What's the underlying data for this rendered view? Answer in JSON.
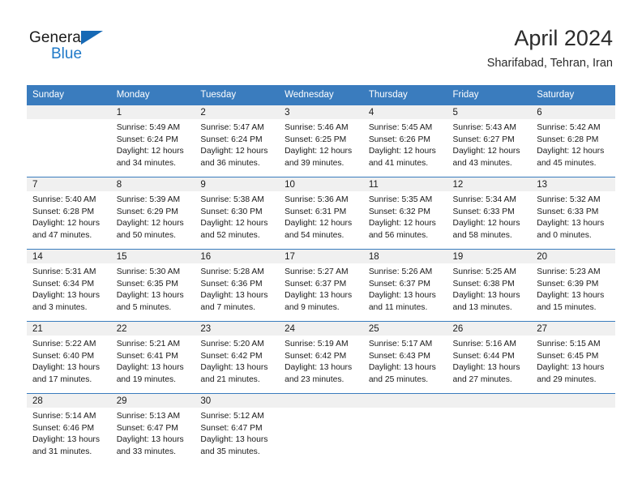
{
  "logo": {
    "text_top": "General",
    "text_bottom": "Blue",
    "triangle_color": "#1669b5",
    "blue_color": "#1f79c8"
  },
  "header": {
    "title": "April 2024",
    "subtitle": "Sharifabad, Tehran, Iran"
  },
  "theme": {
    "header_blue": "#3a7cbe",
    "daynum_band": "#f0f0f0",
    "text": "#1a1a1a"
  },
  "weekday_headers": [
    "Sunday",
    "Monday",
    "Tuesday",
    "Wednesday",
    "Thursday",
    "Friday",
    "Saturday"
  ],
  "labels": {
    "sunrise_prefix": "Sunrise: ",
    "sunset_prefix": "Sunset: ",
    "daylight_prefix": "Daylight: "
  },
  "weeks": [
    [
      {
        "day": "",
        "sunrise": "",
        "sunset": "",
        "daylight_line1": "",
        "daylight_line2": ""
      },
      {
        "day": "1",
        "sunrise": "Sunrise: 5:49 AM",
        "sunset": "Sunset: 6:24 PM",
        "daylight_line1": "Daylight: 12 hours",
        "daylight_line2": "and 34 minutes."
      },
      {
        "day": "2",
        "sunrise": "Sunrise: 5:47 AM",
        "sunset": "Sunset: 6:24 PM",
        "daylight_line1": "Daylight: 12 hours",
        "daylight_line2": "and 36 minutes."
      },
      {
        "day": "3",
        "sunrise": "Sunrise: 5:46 AM",
        "sunset": "Sunset: 6:25 PM",
        "daylight_line1": "Daylight: 12 hours",
        "daylight_line2": "and 39 minutes."
      },
      {
        "day": "4",
        "sunrise": "Sunrise: 5:45 AM",
        "sunset": "Sunset: 6:26 PM",
        "daylight_line1": "Daylight: 12 hours",
        "daylight_line2": "and 41 minutes."
      },
      {
        "day": "5",
        "sunrise": "Sunrise: 5:43 AM",
        "sunset": "Sunset: 6:27 PM",
        "daylight_line1": "Daylight: 12 hours",
        "daylight_line2": "and 43 minutes."
      },
      {
        "day": "6",
        "sunrise": "Sunrise: 5:42 AM",
        "sunset": "Sunset: 6:28 PM",
        "daylight_line1": "Daylight: 12 hours",
        "daylight_line2": "and 45 minutes."
      }
    ],
    [
      {
        "day": "7",
        "sunrise": "Sunrise: 5:40 AM",
        "sunset": "Sunset: 6:28 PM",
        "daylight_line1": "Daylight: 12 hours",
        "daylight_line2": "and 47 minutes."
      },
      {
        "day": "8",
        "sunrise": "Sunrise: 5:39 AM",
        "sunset": "Sunset: 6:29 PM",
        "daylight_line1": "Daylight: 12 hours",
        "daylight_line2": "and 50 minutes."
      },
      {
        "day": "9",
        "sunrise": "Sunrise: 5:38 AM",
        "sunset": "Sunset: 6:30 PM",
        "daylight_line1": "Daylight: 12 hours",
        "daylight_line2": "and 52 minutes."
      },
      {
        "day": "10",
        "sunrise": "Sunrise: 5:36 AM",
        "sunset": "Sunset: 6:31 PM",
        "daylight_line1": "Daylight: 12 hours",
        "daylight_line2": "and 54 minutes."
      },
      {
        "day": "11",
        "sunrise": "Sunrise: 5:35 AM",
        "sunset": "Sunset: 6:32 PM",
        "daylight_line1": "Daylight: 12 hours",
        "daylight_line2": "and 56 minutes."
      },
      {
        "day": "12",
        "sunrise": "Sunrise: 5:34 AM",
        "sunset": "Sunset: 6:33 PM",
        "daylight_line1": "Daylight: 12 hours",
        "daylight_line2": "and 58 minutes."
      },
      {
        "day": "13",
        "sunrise": "Sunrise: 5:32 AM",
        "sunset": "Sunset: 6:33 PM",
        "daylight_line1": "Daylight: 13 hours",
        "daylight_line2": "and 0 minutes."
      }
    ],
    [
      {
        "day": "14",
        "sunrise": "Sunrise: 5:31 AM",
        "sunset": "Sunset: 6:34 PM",
        "daylight_line1": "Daylight: 13 hours",
        "daylight_line2": "and 3 minutes."
      },
      {
        "day": "15",
        "sunrise": "Sunrise: 5:30 AM",
        "sunset": "Sunset: 6:35 PM",
        "daylight_line1": "Daylight: 13 hours",
        "daylight_line2": "and 5 minutes."
      },
      {
        "day": "16",
        "sunrise": "Sunrise: 5:28 AM",
        "sunset": "Sunset: 6:36 PM",
        "daylight_line1": "Daylight: 13 hours",
        "daylight_line2": "and 7 minutes."
      },
      {
        "day": "17",
        "sunrise": "Sunrise: 5:27 AM",
        "sunset": "Sunset: 6:37 PM",
        "daylight_line1": "Daylight: 13 hours",
        "daylight_line2": "and 9 minutes."
      },
      {
        "day": "18",
        "sunrise": "Sunrise: 5:26 AM",
        "sunset": "Sunset: 6:37 PM",
        "daylight_line1": "Daylight: 13 hours",
        "daylight_line2": "and 11 minutes."
      },
      {
        "day": "19",
        "sunrise": "Sunrise: 5:25 AM",
        "sunset": "Sunset: 6:38 PM",
        "daylight_line1": "Daylight: 13 hours",
        "daylight_line2": "and 13 minutes."
      },
      {
        "day": "20",
        "sunrise": "Sunrise: 5:23 AM",
        "sunset": "Sunset: 6:39 PM",
        "daylight_line1": "Daylight: 13 hours",
        "daylight_line2": "and 15 minutes."
      }
    ],
    [
      {
        "day": "21",
        "sunrise": "Sunrise: 5:22 AM",
        "sunset": "Sunset: 6:40 PM",
        "daylight_line1": "Daylight: 13 hours",
        "daylight_line2": "and 17 minutes."
      },
      {
        "day": "22",
        "sunrise": "Sunrise: 5:21 AM",
        "sunset": "Sunset: 6:41 PM",
        "daylight_line1": "Daylight: 13 hours",
        "daylight_line2": "and 19 minutes."
      },
      {
        "day": "23",
        "sunrise": "Sunrise: 5:20 AM",
        "sunset": "Sunset: 6:42 PM",
        "daylight_line1": "Daylight: 13 hours",
        "daylight_line2": "and 21 minutes."
      },
      {
        "day": "24",
        "sunrise": "Sunrise: 5:19 AM",
        "sunset": "Sunset: 6:42 PM",
        "daylight_line1": "Daylight: 13 hours",
        "daylight_line2": "and 23 minutes."
      },
      {
        "day": "25",
        "sunrise": "Sunrise: 5:17 AM",
        "sunset": "Sunset: 6:43 PM",
        "daylight_line1": "Daylight: 13 hours",
        "daylight_line2": "and 25 minutes."
      },
      {
        "day": "26",
        "sunrise": "Sunrise: 5:16 AM",
        "sunset": "Sunset: 6:44 PM",
        "daylight_line1": "Daylight: 13 hours",
        "daylight_line2": "and 27 minutes."
      },
      {
        "day": "27",
        "sunrise": "Sunrise: 5:15 AM",
        "sunset": "Sunset: 6:45 PM",
        "daylight_line1": "Daylight: 13 hours",
        "daylight_line2": "and 29 minutes."
      }
    ],
    [
      {
        "day": "28",
        "sunrise": "Sunrise: 5:14 AM",
        "sunset": "Sunset: 6:46 PM",
        "daylight_line1": "Daylight: 13 hours",
        "daylight_line2": "and 31 minutes."
      },
      {
        "day": "29",
        "sunrise": "Sunrise: 5:13 AM",
        "sunset": "Sunset: 6:47 PM",
        "daylight_line1": "Daylight: 13 hours",
        "daylight_line2": "and 33 minutes."
      },
      {
        "day": "30",
        "sunrise": "Sunrise: 5:12 AM",
        "sunset": "Sunset: 6:47 PM",
        "daylight_line1": "Daylight: 13 hours",
        "daylight_line2": "and 35 minutes."
      },
      {
        "day": "",
        "sunrise": "",
        "sunset": "",
        "daylight_line1": "",
        "daylight_line2": ""
      },
      {
        "day": "",
        "sunrise": "",
        "sunset": "",
        "daylight_line1": "",
        "daylight_line2": ""
      },
      {
        "day": "",
        "sunrise": "",
        "sunset": "",
        "daylight_line1": "",
        "daylight_line2": ""
      },
      {
        "day": "",
        "sunrise": "",
        "sunset": "",
        "daylight_line1": "",
        "daylight_line2": ""
      }
    ]
  ]
}
